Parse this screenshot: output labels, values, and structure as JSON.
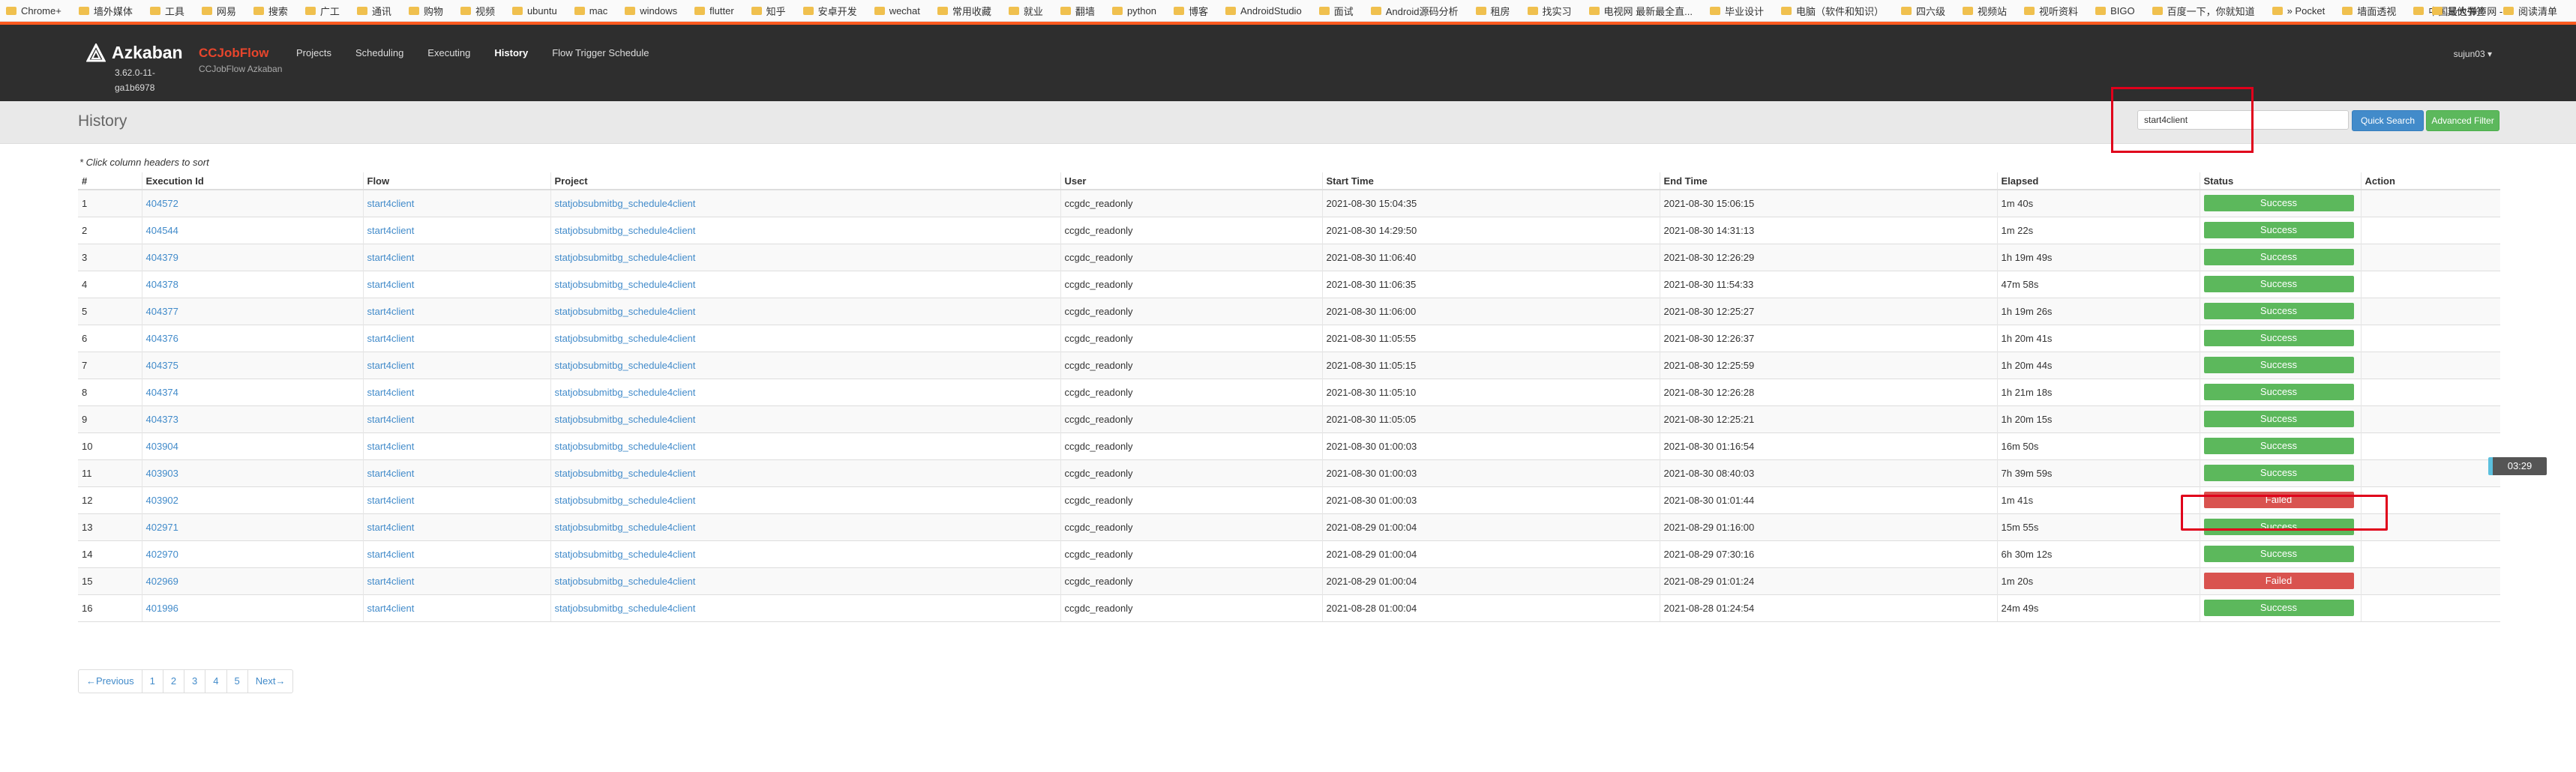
{
  "bookmarks": [
    "Chrome+",
    "墙外媒体",
    "工具",
    "网易",
    "搜索",
    "广工",
    "通讯",
    "购物",
    "视频",
    "ubuntu",
    "mac",
    "windows",
    "flutter",
    "知乎",
    "安卓开发",
    "wechat",
    "常用收藏",
    "就业",
    "翻墙",
    "python",
    "博客",
    "AndroidStudio",
    "面试",
    "Android源码分析",
    "租房",
    "找实习",
    "电视网 最新最全直...",
    "毕业设计",
    "电脑（软件和知识）",
    "四六级",
    "视频站",
    "视听资料",
    "BIGO",
    "百度一下，你就知道",
    "» Pocket",
    "墙面透视",
    "中国最大弹声网 - ..."
  ],
  "bookmarks_right": [
    "其他书签",
    "阅读清单"
  ],
  "navbar": {
    "brand": "Azkaban",
    "version": "3.62.0-11-ga1b6978",
    "project_title": "CCJobFlow",
    "project_subtitle": "CCJobFlow Azkaban",
    "links": [
      "Projects",
      "Scheduling",
      "Executing",
      "History",
      "Flow Trigger Schedule"
    ],
    "active_link": "History",
    "user": "sujun03 ▾"
  },
  "header": {
    "title": "History",
    "search_value": "start4client",
    "quick_search_label": "Quick Search",
    "advanced_filter_label": "Advanced Filter"
  },
  "hint": "* Click column headers to sort",
  "table": {
    "columns": [
      "#",
      "Execution Id",
      "Flow",
      "Project",
      "User",
      "Start Time",
      "End Time",
      "Elapsed",
      "Status",
      "Action"
    ],
    "rows": [
      [
        "1",
        "404572",
        "start4client",
        "statjobsubmitbg_schedule4client",
        "ccgdc_readonly",
        "2021-08-30 15:04:35",
        "2021-08-30 15:06:15",
        "1m 40s",
        "Success"
      ],
      [
        "2",
        "404544",
        "start4client",
        "statjobsubmitbg_schedule4client",
        "ccgdc_readonly",
        "2021-08-30 14:29:50",
        "2021-08-30 14:31:13",
        "1m 22s",
        "Success"
      ],
      [
        "3",
        "404379",
        "start4client",
        "statjobsubmitbg_schedule4client",
        "ccgdc_readonly",
        "2021-08-30 11:06:40",
        "2021-08-30 12:26:29",
        "1h 19m 49s",
        "Success"
      ],
      [
        "4",
        "404378",
        "start4client",
        "statjobsubmitbg_schedule4client",
        "ccgdc_readonly",
        "2021-08-30 11:06:35",
        "2021-08-30 11:54:33",
        "47m 58s",
        "Success"
      ],
      [
        "5",
        "404377",
        "start4client",
        "statjobsubmitbg_schedule4client",
        "ccgdc_readonly",
        "2021-08-30 11:06:00",
        "2021-08-30 12:25:27",
        "1h 19m 26s",
        "Success"
      ],
      [
        "6",
        "404376",
        "start4client",
        "statjobsubmitbg_schedule4client",
        "ccgdc_readonly",
        "2021-08-30 11:05:55",
        "2021-08-30 12:26:37",
        "1h 20m 41s",
        "Success"
      ],
      [
        "7",
        "404375",
        "start4client",
        "statjobsubmitbg_schedule4client",
        "ccgdc_readonly",
        "2021-08-30 11:05:15",
        "2021-08-30 12:25:59",
        "1h 20m 44s",
        "Success"
      ],
      [
        "8",
        "404374",
        "start4client",
        "statjobsubmitbg_schedule4client",
        "ccgdc_readonly",
        "2021-08-30 11:05:10",
        "2021-08-30 12:26:28",
        "1h 21m 18s",
        "Success"
      ],
      [
        "9",
        "404373",
        "start4client",
        "statjobsubmitbg_schedule4client",
        "ccgdc_readonly",
        "2021-08-30 11:05:05",
        "2021-08-30 12:25:21",
        "1h 20m 15s",
        "Success"
      ],
      [
        "10",
        "403904",
        "start4client",
        "statjobsubmitbg_schedule4client",
        "ccgdc_readonly",
        "2021-08-30 01:00:03",
        "2021-08-30 01:16:54",
        "16m 50s",
        "Success"
      ],
      [
        "11",
        "403903",
        "start4client",
        "statjobsubmitbg_schedule4client",
        "ccgdc_readonly",
        "2021-08-30 01:00:03",
        "2021-08-30 08:40:03",
        "7h 39m 59s",
        "Success"
      ],
      [
        "12",
        "403902",
        "start4client",
        "statjobsubmitbg_schedule4client",
        "ccgdc_readonly",
        "2021-08-30 01:00:03",
        "2021-08-30 01:01:44",
        "1m 41s",
        "Failed"
      ],
      [
        "13",
        "402971",
        "start4client",
        "statjobsubmitbg_schedule4client",
        "ccgdc_readonly",
        "2021-08-29 01:00:04",
        "2021-08-29 01:16:00",
        "15m 55s",
        "Success"
      ],
      [
        "14",
        "402970",
        "start4client",
        "statjobsubmitbg_schedule4client",
        "ccgdc_readonly",
        "2021-08-29 01:00:04",
        "2021-08-29 07:30:16",
        "6h 30m 12s",
        "Success"
      ],
      [
        "15",
        "402969",
        "start4client",
        "statjobsubmitbg_schedule4client",
        "ccgdc_readonly",
        "2021-08-29 01:00:04",
        "2021-08-29 01:01:24",
        "1m 20s",
        "Failed"
      ],
      [
        "16",
        "401996",
        "start4client",
        "statjobsubmitbg_schedule4client",
        "ccgdc_readonly",
        "2021-08-28 01:00:04",
        "2021-08-28 01:24:54",
        "24m 49s",
        "Success"
      ]
    ]
  },
  "pagination": [
    "←Previous",
    "1",
    "2",
    "3",
    "4",
    "5",
    "Next→"
  ],
  "clock": "03:29",
  "colors": {
    "accent_orange": "#ff5a1f",
    "success": "#5cb85c",
    "failed": "#d9534f",
    "link": "#428bca",
    "highlight": "#e0001b"
  }
}
